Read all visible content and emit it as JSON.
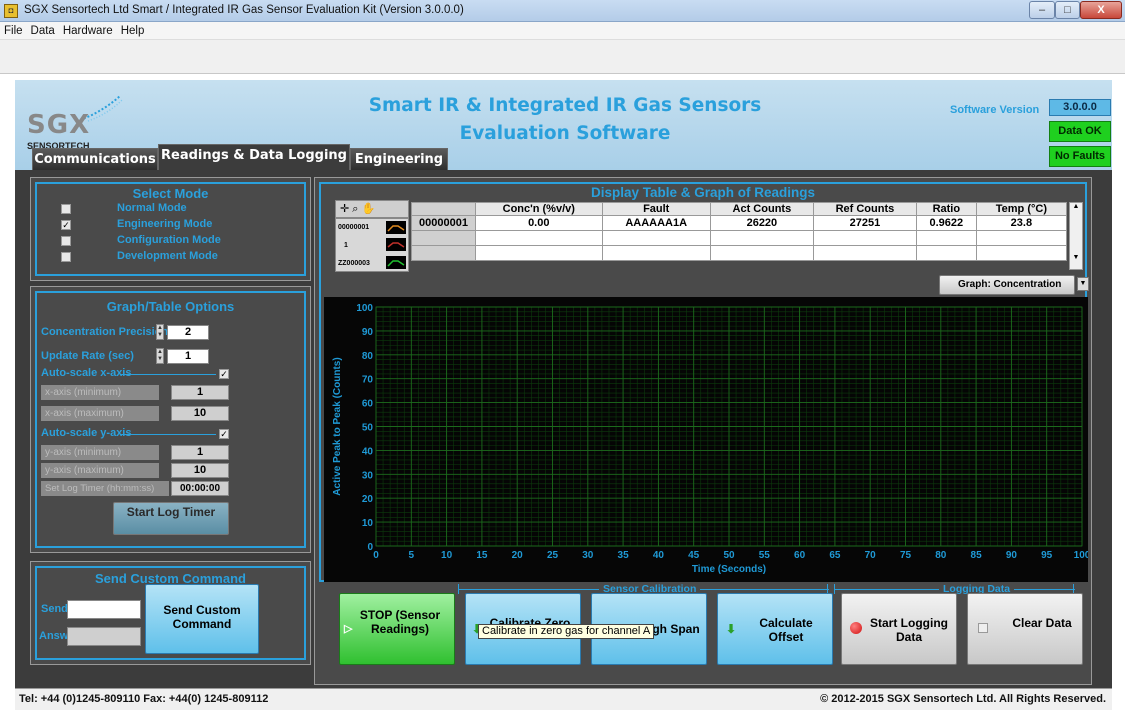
{
  "window": {
    "title": "SGX Sensortech Ltd Smart / Integrated IR Gas Sensor Evaluation Kit (Version 3.0.0.0)",
    "min": "–",
    "max": "□",
    "close": "X"
  },
  "menu": [
    "File",
    "Data",
    "Hardware",
    "Help"
  ],
  "header": {
    "logo": "SGX",
    "logo_sub": "SENSORTECH",
    "title_line1": "Smart IR & Integrated IR Gas Sensors",
    "title_line2": "Evaluation Software",
    "software_version_label": "Software Version",
    "software_version": "3.0.0.0",
    "data_status": "Data OK",
    "fault_status": "No Faults"
  },
  "tabs": [
    {
      "label": "Communications"
    },
    {
      "label": "Readings & Data Logging",
      "active": true
    },
    {
      "label": "Engineering"
    }
  ],
  "select_mode": {
    "title": "Select Mode",
    "modes": [
      {
        "label": "Normal Mode",
        "checked": false
      },
      {
        "label": "Engineering Mode",
        "checked": true
      },
      {
        "label": "Configuration Mode",
        "checked": false
      },
      {
        "label": "Development Mode",
        "checked": false
      }
    ]
  },
  "graph_options": {
    "title": "Graph/Table Options",
    "conc_precision_label": "Concentration Precision",
    "conc_precision": "2",
    "update_rate_label": "Update Rate (sec)",
    "update_rate": "1",
    "autoscale_x_label": "Auto-scale x-axis",
    "autoscale_x": true,
    "x_min_label": "x-axis (minimum)",
    "x_min": "1",
    "x_max_label": "x-axis (maximum)",
    "x_max": "10",
    "autoscale_y_label": "Auto-scale y-axis",
    "autoscale_y": true,
    "y_min_label": "y-axis (minimum)",
    "y_min": "1",
    "y_max_label": "y-axis (maximum)",
    "y_max": "10",
    "log_timer_label": "Set Log Timer (hh:mm:ss)",
    "log_timer": "00:00:00",
    "start_log_timer": "Start Log Timer"
  },
  "custom_command": {
    "title": "Send Custom Command",
    "send_label": "Send",
    "answer_label": "Answer",
    "send_value": "",
    "answer_value": "",
    "button": "Send Custom Command"
  },
  "display": {
    "title": "Display Table & Graph of Readings",
    "legend": [
      {
        "label": "00000001",
        "color": "#e08a20"
      },
      {
        "label": "1",
        "color": "#c0302a"
      },
      {
        "label": "ZZ000003",
        "color": "#20c030"
      }
    ],
    "columns": [
      "Conc'n (%v/v)",
      "Fault",
      "Act Counts",
      "Ref Counts",
      "Ratio",
      "Temp (°C)"
    ],
    "rows": [
      {
        "id": "00000001",
        "cells": [
          "0.00",
          "AAAAAA1A",
          "26220",
          "27251",
          "0.9622",
          "23.8"
        ]
      },
      {
        "id": "",
        "cells": [
          "",
          "",
          "",
          "",
          "",
          ""
        ]
      },
      {
        "id": "",
        "cells": [
          "",
          "",
          "",
          "",
          "",
          ""
        ]
      }
    ],
    "graph_select": "Graph: Concentration"
  },
  "chart_data": {
    "type": "line",
    "title": "",
    "xlabel": "Time (Seconds)",
    "ylabel": "Active Peak to Peak (Counts)",
    "xlim": [
      0,
      100
    ],
    "ylim": [
      0,
      100
    ],
    "xticks": [
      0,
      5,
      10,
      15,
      20,
      25,
      30,
      35,
      40,
      45,
      50,
      55,
      60,
      65,
      70,
      75,
      80,
      85,
      90,
      95,
      100
    ],
    "yticks": [
      0,
      10,
      20,
      30,
      40,
      50,
      60,
      70,
      80,
      90,
      100
    ],
    "series": [],
    "grid": true
  },
  "bottom": {
    "stop_button": "STOP (Sensor Readings)",
    "sensor_calibration_label": "Sensor Calibration",
    "logging_data_label": "Logging Data",
    "calibrate_zero": "Calibrate Zero",
    "tooltip": "Calibrate in zero gas for channel A",
    "calibrate_high_span": "Set High Span",
    "calculate_offset": "Calculate Offset",
    "start_logging": "Start Logging Data",
    "clear_data": "Clear Data"
  },
  "footer": {
    "contact": "Tel: +44 (0)1245-809110 Fax: +44(0) 1245-809112",
    "copyright": "© 2012-2015 SGX Sensortech Ltd. All Rights Reserved."
  }
}
